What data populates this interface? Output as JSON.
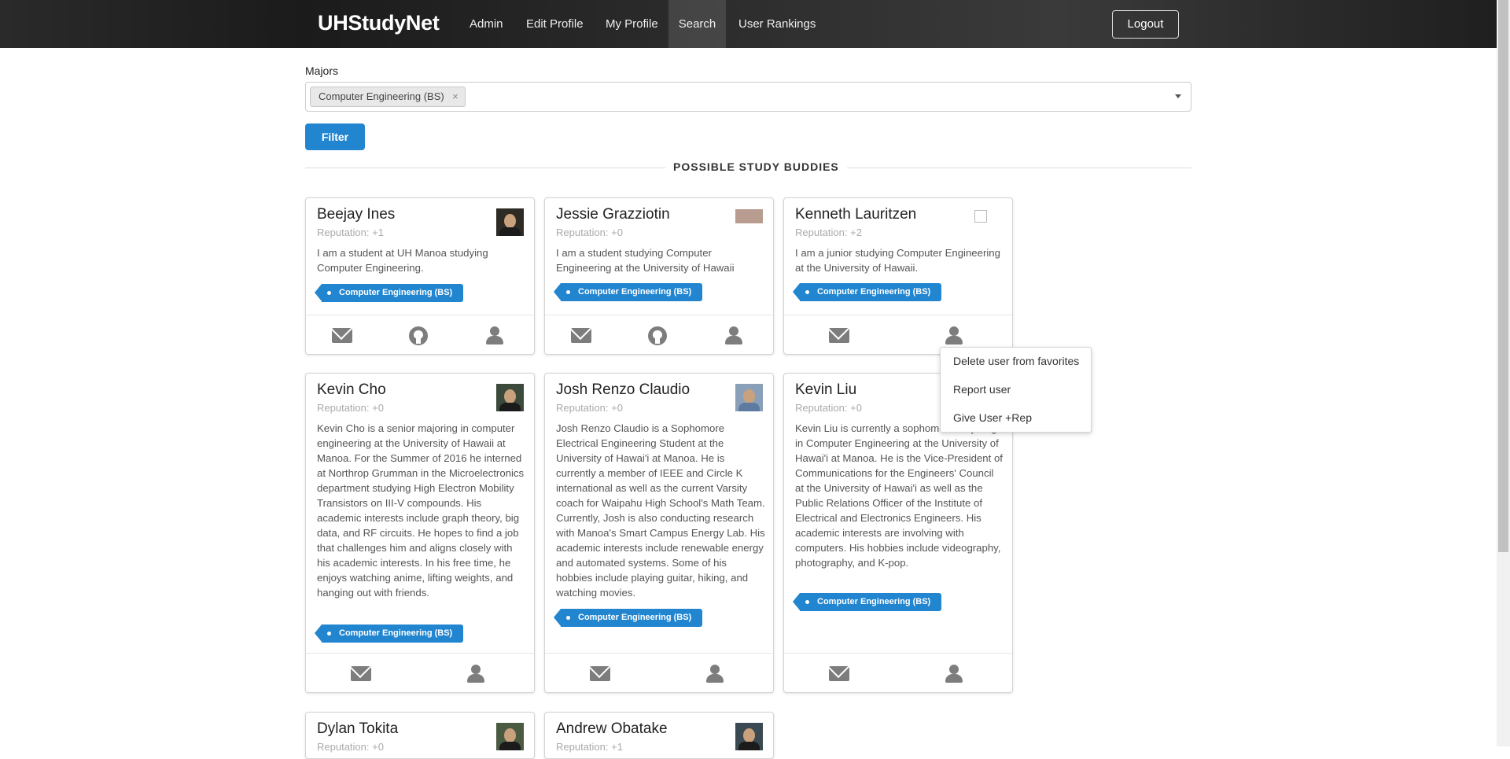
{
  "nav": {
    "brand": "UHStudyNet",
    "items": [
      "Admin",
      "Edit Profile",
      "My Profile",
      "Search",
      "User Rankings"
    ],
    "active": "Search",
    "logout_label": "Logout"
  },
  "filter": {
    "label": "Majors",
    "selected_chip": "Computer Engineering (BS)",
    "chip_remove": "×",
    "button_label": "Filter"
  },
  "section_title": "POSSIBLE STUDY BUDDIES",
  "cards": [
    {
      "name": "Beejay Ines",
      "reputation": "Reputation: +1",
      "bio": "I am a student at UH Manoa studying Computer Engineering.",
      "tag": "Computer Engineering (BS)",
      "actions": [
        "mail-icon",
        "github-icon",
        "user-icon"
      ]
    },
    {
      "name": "Jessie Grazziotin",
      "reputation": "Reputation: +0",
      "bio": "I am a student studying Computer Engineering at the University of Hawaii",
      "tag": "Computer Engineering (BS)",
      "actions": [
        "mail-icon",
        "github-icon",
        "user-icon"
      ]
    },
    {
      "name": "Kenneth Lauritzen",
      "reputation": "Reputation: +2",
      "bio": "I am a junior studying Computer Engineering at the University of Hawaii.",
      "tag": "Computer Engineering (BS)",
      "actions": [
        "mail-icon",
        "user-icon"
      ]
    },
    {
      "name": "Kevin Cho",
      "reputation": "Reputation: +0",
      "bio": "Kevin Cho is a senior majoring in computer engineering at the University of Hawaii at Manoa. For the Summer of 2016 he interned at Northrop Grumman in the Microelectronics department studying High Electron Mobility Transistors on III-V compounds. His academic interests include graph theory, big data, and RF circuits. He hopes to find a job that challenges him and aligns closely with his academic interests. In his free time, he enjoys watching anime, lifting weights, and hanging out with friends.",
      "tag": "Computer Engineering (BS)",
      "actions": [
        "mail-icon",
        "user-icon"
      ]
    },
    {
      "name": "Josh Renzo Claudio",
      "reputation": "Reputation: +0",
      "bio": "Josh Renzo Claudio is a Sophomore Electrical Engineering Student at the University of Hawai'i at Manoa. He is currently a member of IEEE and Circle K international as well as the current Varsity coach for Waipahu High School's Math Team. Currently, Josh is also conducting research with Manoa's Smart Campus Energy Lab. His academic interests include renewable energy and automated systems. Some of his hobbies include playing guitar, hiking, and watching movies.",
      "tag": "Computer Engineering (BS)",
      "actions": [
        "mail-icon",
        "user-icon"
      ]
    },
    {
      "name": "Kevin Liu",
      "reputation": "Reputation: +0",
      "bio": "Kevin Liu is currently a sophomore majoring in Computer Engineering at the University of Hawai'i at Manoa. He is the Vice-President of Communications for the Engineers' Council at the University of Hawai'i as well as the Public Relations Officer of the Institute of Electrical and Electronics Engineers. His academic interests are involving with computers. His hobbies include videography, photography, and K-pop.",
      "tag": "Computer Engineering (BS)",
      "actions": [
        "mail-icon",
        "user-icon"
      ]
    },
    {
      "name": "Dylan Tokita",
      "reputation": "Reputation: +0"
    },
    {
      "name": "Andrew Obatake",
      "reputation": "Reputation: +1"
    }
  ],
  "dropdown": {
    "items": [
      "Delete user from favorites",
      "Report user",
      "Give User +Rep"
    ]
  }
}
